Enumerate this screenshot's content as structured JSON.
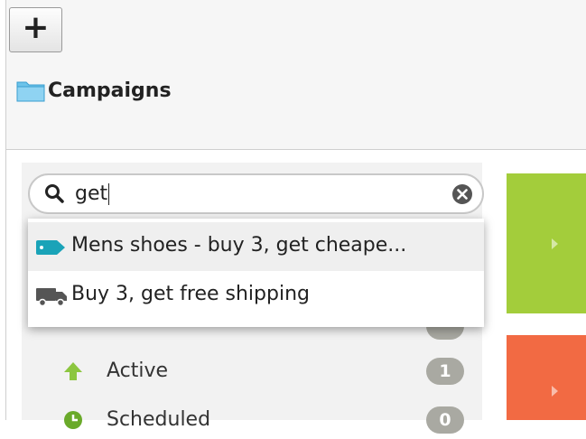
{
  "toolbar": {
    "add_label": "+"
  },
  "breadcrumb": {
    "label": "Campaigns"
  },
  "search": {
    "value": "get",
    "placeholder": ""
  },
  "suggestions": [
    {
      "label": "Mens shoes - buy 3, get cheape...",
      "icon": "tag-icon",
      "icon_color": "#1aa3b8"
    },
    {
      "label": "Buy 3, get free shipping",
      "icon": "truck-icon",
      "icon_color": "#555555"
    }
  ],
  "status_list": [
    {
      "label": "Active",
      "count": "1",
      "icon": "arrow-up-icon",
      "icon_color": "#8cc63f"
    },
    {
      "label": "Scheduled",
      "count": "0",
      "icon": "clock-icon",
      "icon_color": "#6aaa2a"
    }
  ],
  "tiles": [
    {
      "color": "#a3cd3b"
    },
    {
      "color": "#f26a43"
    }
  ]
}
